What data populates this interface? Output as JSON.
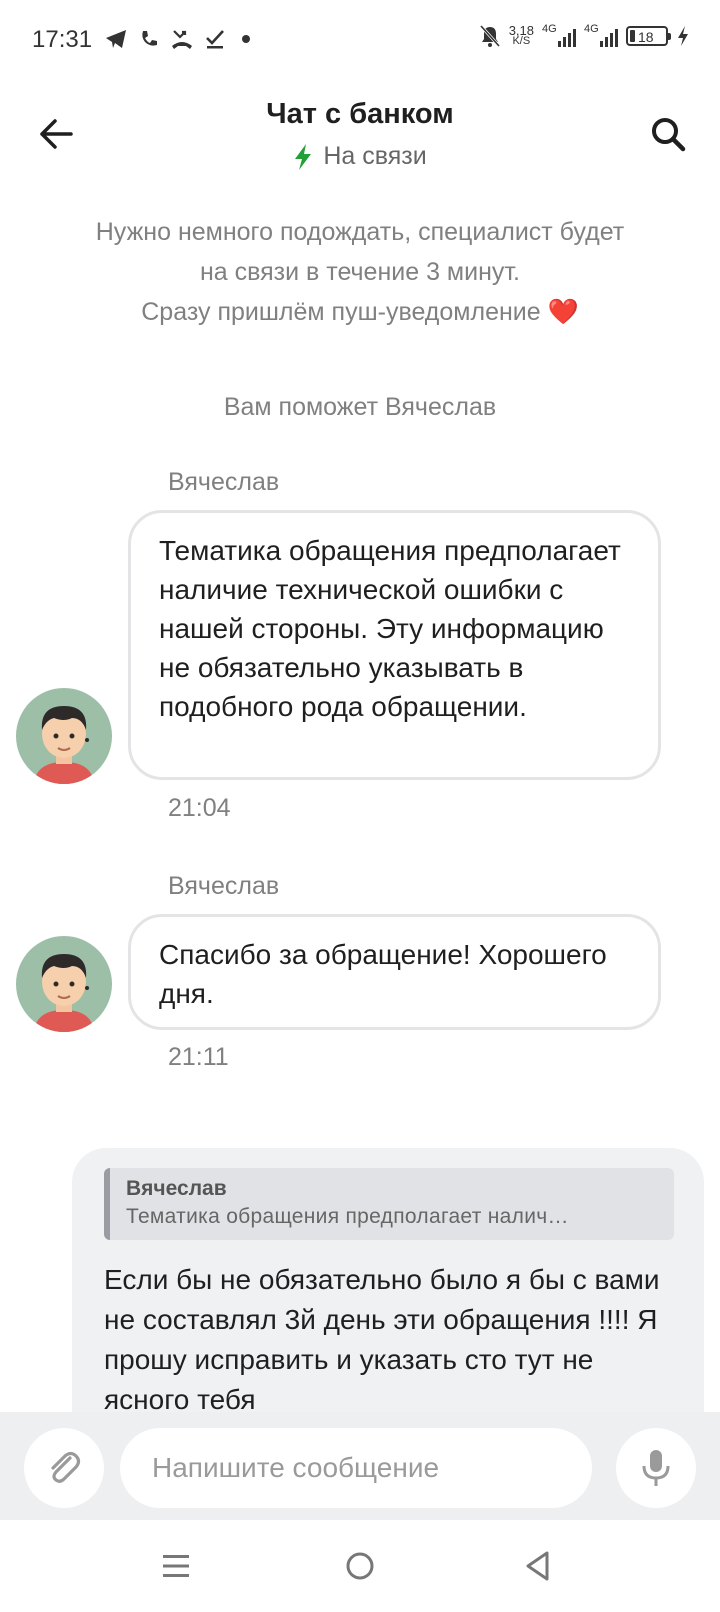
{
  "status_bar": {
    "time": "17:31",
    "net_speed_value": "3,18",
    "net_speed_unit": "K/S",
    "signal1_label": "4G",
    "signal2_label": "4G",
    "battery_level": "18",
    "icons": [
      "telegram-icon",
      "phone-icon",
      "missed-call-icon",
      "check-icon",
      "dot-icon",
      "mute-icon",
      "charging-icon"
    ]
  },
  "header": {
    "title": "Чат с банком",
    "status": "На связи",
    "status_color": "#21a038"
  },
  "info": {
    "line1": "Нужно немного подождать, специалист будет",
    "line2": "на связи в течение 3 минут.",
    "line3": "Сразу пришлём пуш-уведомление",
    "heart": "❤️"
  },
  "helper_note": "Вам поможет Вячеслав",
  "messages": [
    {
      "sender": "Вячеслав",
      "text": "Тематика обращения предполагает наличие технической ошибки с нашей стороны. Эту информацию не обязательно указывать в подобного рода обращении.",
      "time": "21:04"
    },
    {
      "sender": "Вячеслав",
      "text": "Спасибо за обращение! Хорошего дня.",
      "time": "21:11"
    }
  ],
  "outgoing": {
    "quote_author": "Вячеслав",
    "quote_text": "Тематика обращения предполагает налич…",
    "text": "Если бы не обязательно было я бы с вами не составлял 3й день эти обращения !!!! Я прошу исправить и указать сто тут не ясного тебя"
  },
  "composer": {
    "placeholder": "Напишите сообщение"
  },
  "colors": {
    "accent_green": "#21a038",
    "bubble_out_bg": "#f0f1f3",
    "bubble_in_border": "#e4e4e7"
  }
}
